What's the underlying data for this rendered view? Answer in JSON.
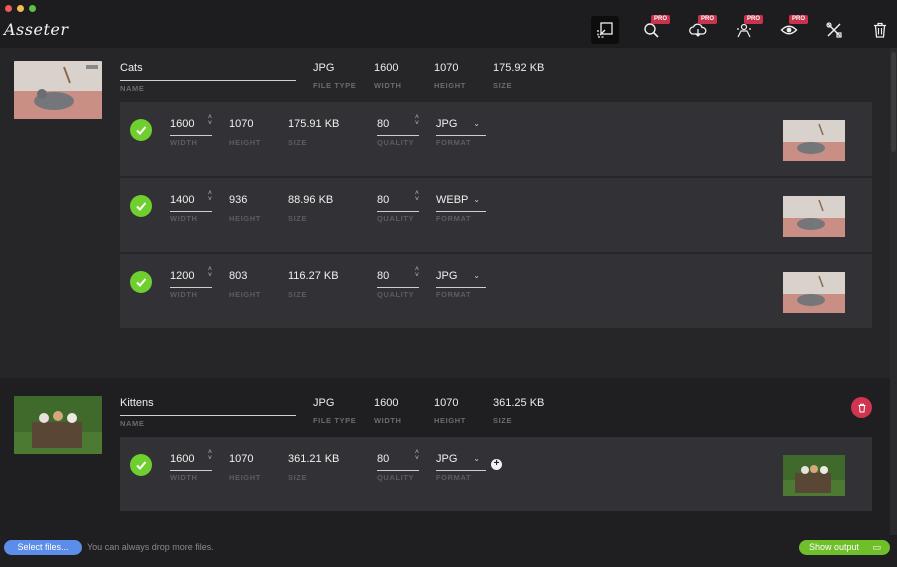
{
  "app": {
    "logo_text": "Asseter"
  },
  "toolbar": {
    "tools": [
      {
        "name": "resize-icon",
        "pro": ""
      },
      {
        "name": "search-icon",
        "pro": "PRO"
      },
      {
        "name": "cloud-upload-icon",
        "pro": "PRO"
      },
      {
        "name": "watermark-icon",
        "pro": "PRO"
      },
      {
        "name": "eye-icon",
        "pro": "PRO"
      },
      {
        "name": "tools-icon",
        "pro": ""
      },
      {
        "name": "trash-icon",
        "pro": ""
      }
    ]
  },
  "labels": {
    "name": "NAME",
    "file_type": "FILE TYPE",
    "width": "WIDTH",
    "height": "HEIGHT",
    "size": "SIZE",
    "quality": "QUALITY",
    "format": "FORMAT"
  },
  "groups": [
    {
      "name": "Cats",
      "file_type": "JPG",
      "width": "1600",
      "height": "1070",
      "size": "175.92 KB",
      "outputs": [
        {
          "width": "1600",
          "height": "1070",
          "size": "175.91 KB",
          "quality": "80",
          "format": "JPG"
        },
        {
          "width": "1400",
          "height": "936",
          "size": "88.96 KB",
          "quality": "80",
          "format": "WEBP"
        },
        {
          "width": "1200",
          "height": "803",
          "size": "116.27 KB",
          "quality": "80",
          "format": "JPG"
        }
      ]
    },
    {
      "name": "Kittens",
      "file_type": "JPG",
      "width": "1600",
      "height": "1070",
      "size": "361.25 KB",
      "outputs": [
        {
          "width": "1600",
          "height": "1070",
          "size": "361.21 KB",
          "quality": "80",
          "format": "JPG"
        }
      ]
    }
  ],
  "bottom": {
    "select_label": "Select files...",
    "hint": "You can always drop more files.",
    "show_output_label": "Show output"
  },
  "colors": {
    "accent_green": "#6fcf2e",
    "select_blue": "#5c8de8",
    "pro_red": "#c8344d",
    "delete_red": "#d0344f"
  }
}
